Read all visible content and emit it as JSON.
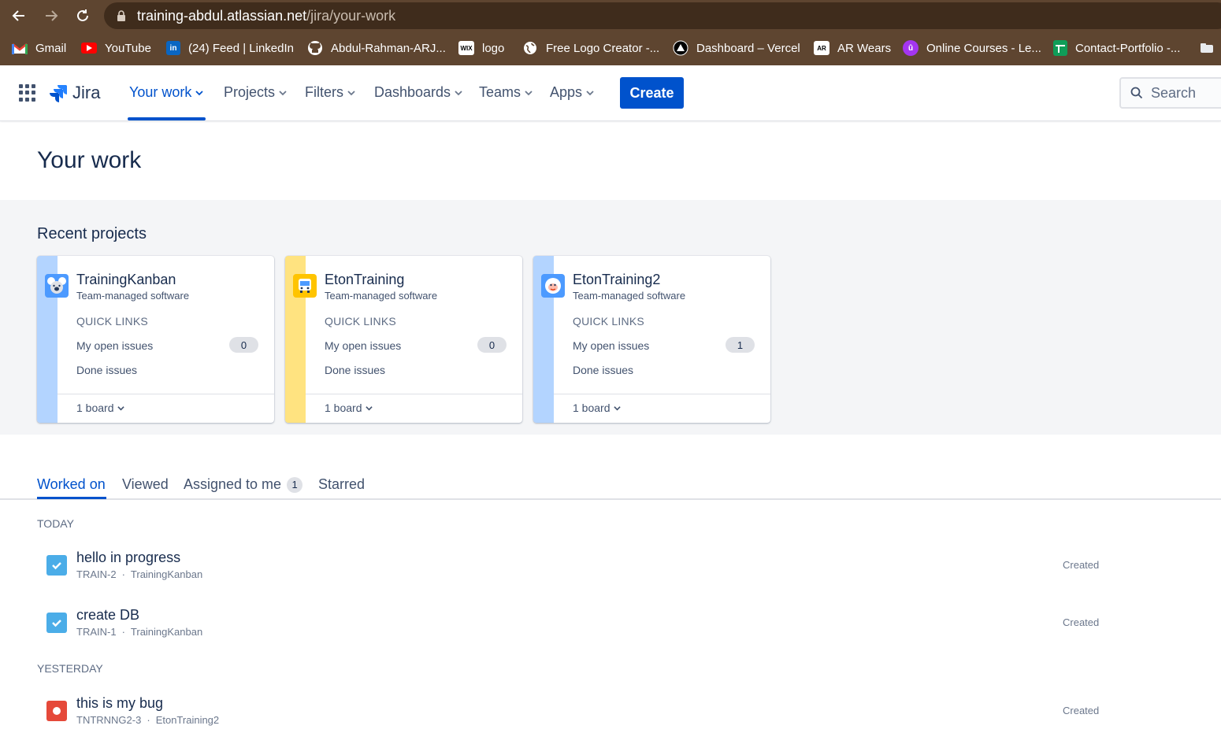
{
  "browser": {
    "url_host": "training-abdul.atlassian.net",
    "url_path": "/jira/your-work",
    "bookmarks": [
      {
        "label": "Gmail",
        "icon": "gmail-icon"
      },
      {
        "label": "YouTube",
        "icon": "youtube-icon"
      },
      {
        "label": "(24) Feed | LinkedIn",
        "icon": "linkedin-icon"
      },
      {
        "label": "Abdul-Rahman-ARJ...",
        "icon": "github-icon"
      },
      {
        "label": "logo",
        "icon": "wix-icon"
      },
      {
        "label": "Free Logo Creator -...",
        "icon": "globe-icon"
      },
      {
        "label": "Dashboard – Vercel",
        "icon": "vercel-icon"
      },
      {
        "label": "AR Wears",
        "icon": "ar-icon"
      },
      {
        "label": "Online Courses - Le...",
        "icon": "udemy-icon"
      },
      {
        "label": "Contact-Portfolio -...",
        "icon": "sheets-icon"
      }
    ]
  },
  "topnav": {
    "brand": "Jira",
    "items": [
      {
        "label": "Your work",
        "active": true
      },
      {
        "label": "Projects",
        "active": false
      },
      {
        "label": "Filters",
        "active": false
      },
      {
        "label": "Dashboards",
        "active": false
      },
      {
        "label": "Teams",
        "active": false
      },
      {
        "label": "Apps",
        "active": false
      }
    ],
    "create_label": "Create",
    "search_placeholder": "Search"
  },
  "page": {
    "title": "Your work"
  },
  "recent_projects": {
    "heading": "Recent projects",
    "cards": [
      {
        "name": "TrainingKanban",
        "type": "Team-managed software",
        "quick_links_label": "QUICK LINKS",
        "open_issues_label": "My open issues",
        "open_issues_count": "0",
        "done_label": "Done issues",
        "boards_label": "1 board",
        "stripe_color": "#b3d4ff",
        "avatar_icon": "koala-avatar-icon"
      },
      {
        "name": "EtonTraining",
        "type": "Team-managed software",
        "quick_links_label": "QUICK LINKS",
        "open_issues_label": "My open issues",
        "open_issues_count": "0",
        "done_label": "Done issues",
        "boards_label": "1 board",
        "stripe_color": "#ffe380",
        "avatar_icon": "bus-avatar-icon"
      },
      {
        "name": "EtonTraining2",
        "type": "Team-managed software",
        "quick_links_label": "QUICK LINKS",
        "open_issues_label": "My open issues",
        "open_issues_count": "1",
        "done_label": "Done issues",
        "boards_label": "1 board",
        "stripe_color": "#b3d4ff",
        "avatar_icon": "yeti-avatar-icon"
      }
    ]
  },
  "tabs": [
    {
      "label": "Worked on",
      "active": true
    },
    {
      "label": "Viewed",
      "active": false
    },
    {
      "label": "Assigned to me",
      "active": false,
      "count": "1"
    },
    {
      "label": "Starred",
      "active": false
    }
  ],
  "activity": {
    "groups": [
      {
        "label": "TODAY",
        "items": [
          {
            "title": "hello in progress",
            "key": "TRAIN-2",
            "project": "TrainingKanban",
            "status": "Created",
            "issue_type": "task",
            "icon": "task-checkbox-icon"
          },
          {
            "title": "create DB",
            "key": "TRAIN-1",
            "project": "TrainingKanban",
            "status": "Created",
            "issue_type": "task",
            "icon": "task-checkbox-icon"
          }
        ]
      },
      {
        "label": "YESTERDAY",
        "items": [
          {
            "title": "this is my bug",
            "key": "TNTRNNG2-3",
            "project": "EtonTraining2",
            "status": "Created",
            "issue_type": "bug",
            "icon": "bug-icon"
          }
        ]
      }
    ]
  },
  "colors": {
    "accent": "#0052cc",
    "task": "#4bade8",
    "bug": "#e5493a",
    "chrome": "#5e4530"
  }
}
